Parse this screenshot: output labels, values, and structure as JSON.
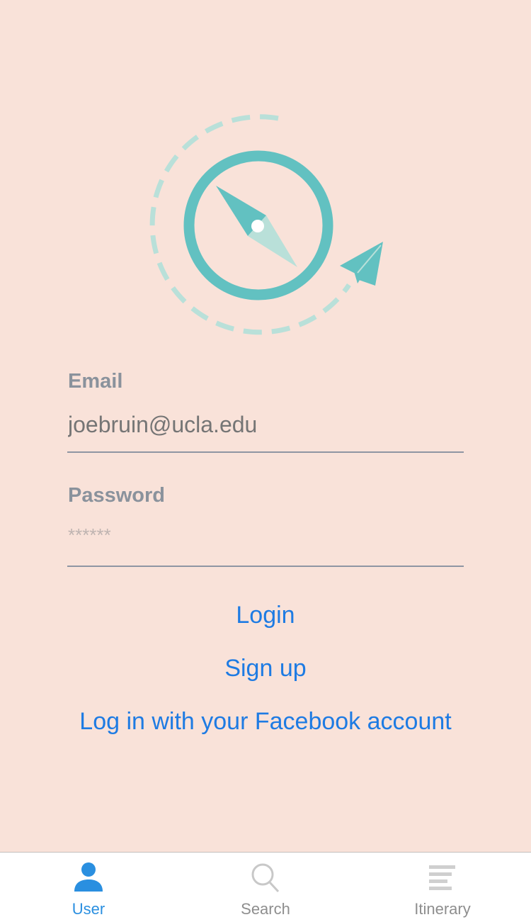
{
  "colors": {
    "background": "#f9e2d9",
    "accent": "#1e7be3",
    "logo_teal": "#62c1c1",
    "logo_light": "#b9e0d9"
  },
  "logo": {
    "icon": "compass-paper-plane-logo"
  },
  "form": {
    "email_label": "Email",
    "email_placeholder": "joebruin@ucla.edu",
    "password_label": "Password",
    "password_value": "******"
  },
  "actions": {
    "login": "Login",
    "signup": "Sign up",
    "facebook": "Log in with your Facebook account"
  },
  "tabbar": {
    "items": [
      {
        "label": "User",
        "icon": "user-icon",
        "active": true
      },
      {
        "label": "Search",
        "icon": "search-icon",
        "active": false
      },
      {
        "label": "Itinerary",
        "icon": "list-icon",
        "active": false
      }
    ]
  }
}
